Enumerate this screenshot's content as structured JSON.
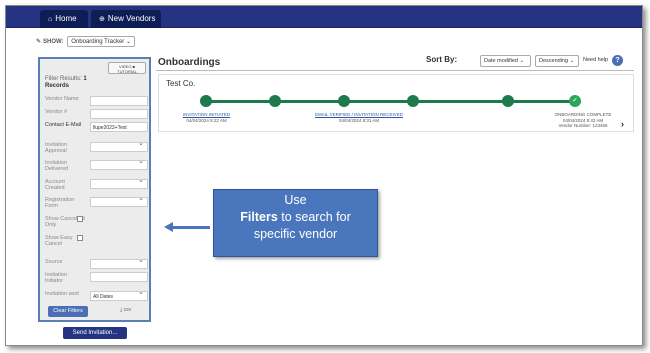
{
  "nav": {
    "home_label": "Home",
    "vendors_label": "New Vendors"
  },
  "show": {
    "label": "SHOW:",
    "value": "Onboarding Tracker"
  },
  "sidebar": {
    "video_label_1": "VIDEO",
    "video_label_2": "TUTORIAL",
    "filter_results": "Filter Results:",
    "filter_count": "1",
    "filter_unit": "Records",
    "vendor_name_label": "Vendor Name",
    "vendor_name_value": "",
    "vendor_num_label": "Vendor #",
    "vendor_num_value": "",
    "contact_email_label": "Contact E-Mail",
    "contact_email_value": "llupe2023+Test",
    "invitation_approval_label": "Invitation Approval",
    "invitation_delivered_label": "Invitation Delivered",
    "account_created_label": "Account Created",
    "registration_form_label": "Registration Form",
    "show_cancelled_label": "Show Cancelled Only",
    "show_easy_cancel_label": "Show Easy Cancel",
    "source_label": "Source",
    "invitation_initiator_label": "Invitation Initiator",
    "invitation_sent_label": "Invitation sent",
    "invitation_sent_value": "All Dates",
    "clear_filters_label": "Clear Filters",
    "csv_label": "csv",
    "send_invitation_label": "Send Invitation..."
  },
  "main": {
    "title": "Onboardings",
    "sort_by_label": "Sort By:",
    "sort_field": "Date modified",
    "sort_order": "Descending",
    "need_help": "Need help",
    "help_icon": "?"
  },
  "card": {
    "company": "Test Co.",
    "steps": [
      {
        "status": "INVITATION INITIATED",
        "date": "04/04/2024 8:22 AM"
      },
      {
        "status": "EMAIL VERIFIED / INVITATION RECEIVED",
        "date": "04/04/2024 8:31 AM"
      },
      {
        "status": "ONBOARDING COMPLETE",
        "date": "04/04/2024 8:43 AM",
        "extra": "Vendor Number: 123456"
      }
    ],
    "check_icon": "✓",
    "arrow": "›"
  },
  "callout": {
    "line1": "Use",
    "line2_bold": "Filters",
    "line2_rest": " to search for",
    "line3": "specific vendor"
  },
  "colors": {
    "nav": "#243480",
    "sidebar_border": "#5b7fb5",
    "progress": "#1e7a4c",
    "callout": "#4a76be"
  }
}
